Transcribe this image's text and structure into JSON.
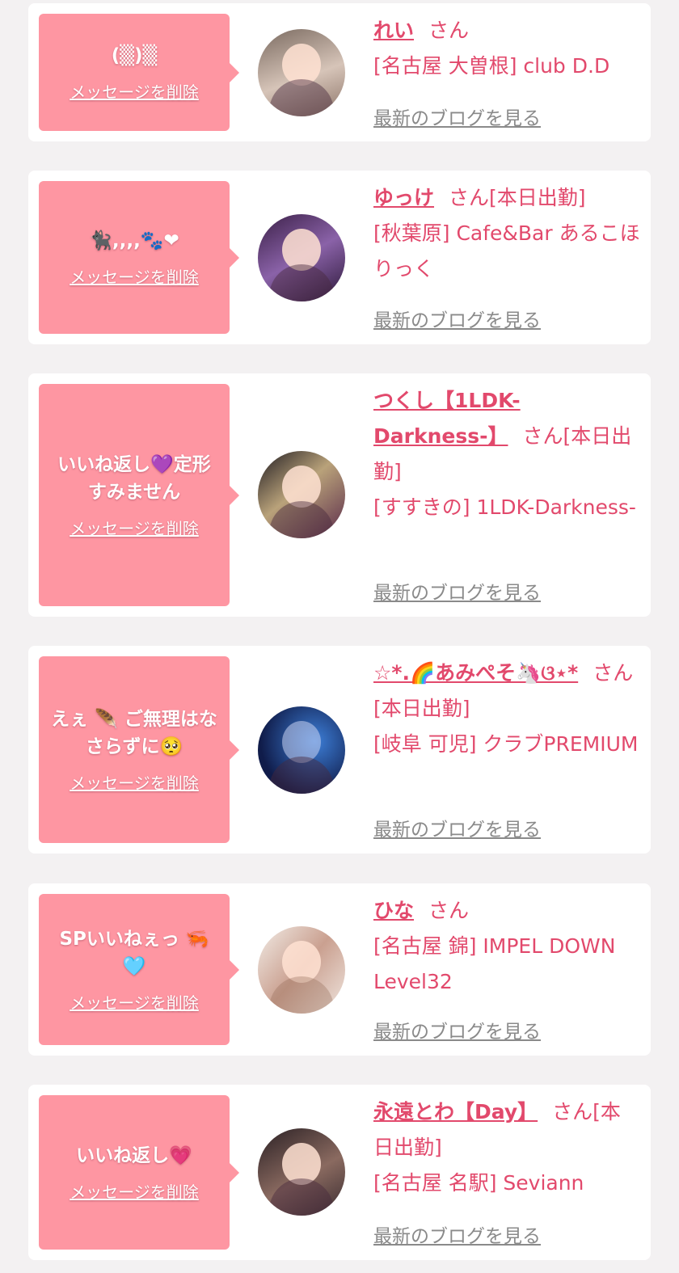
{
  "entries": [
    {
      "message": "(▒)▒",
      "delete_label": "メッセージを削除",
      "name": "れい",
      "suffix": "さん",
      "shop": "[名古屋 大曽根] club D.D",
      "blog_label": "最新のブログを見る"
    },
    {
      "message": "🐈‍⬛,,,,🐾❤",
      "delete_label": "メッセージを削除",
      "name": "ゆっけ",
      "suffix": "さん[本日出勤]",
      "shop": "[秋葉原] Cafe&Bar あるこほりっく",
      "blog_label": "最新のブログを見る"
    },
    {
      "message": "いいね返し💜定形すみません",
      "delete_label": "メッセージを削除",
      "name": "つくし【1LDK-Darkness-】",
      "suffix": "さん[本日出勤]",
      "shop": "[すすきの] 1LDK-Darkness-",
      "blog_label": "最新のブログを見る"
    },
    {
      "message": "えぇ 🪶 ご無理はなさらずに🥺",
      "delete_label": "メッセージを削除",
      "name": "☆*.🌈あみぺそ🦄ଓ⋆*",
      "suffix": "さん[本日出勤]",
      "shop": "[岐阜 可児] クラブPREMIUM",
      "blog_label": "最新のブログを見る"
    },
    {
      "message": "SPいいねぇっ 🦐 🩵",
      "delete_label": "メッセージを削除",
      "name": "ひな",
      "suffix": "さん",
      "shop": "[名古屋 錦] IMPEL DOWN Level32",
      "blog_label": "最新のブログを見る"
    },
    {
      "message": "いいね返し💗",
      "delete_label": "メッセージを削除",
      "name": "永遠とわ【Day】",
      "suffix": "さん[本日出勤]",
      "shop": "[名古屋 名駅] Seviann",
      "blog_label": "最新のブログを見る"
    }
  ],
  "colors": {
    "bubble": "#fe96a2",
    "accent_text": "#e2496c",
    "link_gray": "#8a8a8a",
    "page_background": "#f3f1f2"
  }
}
